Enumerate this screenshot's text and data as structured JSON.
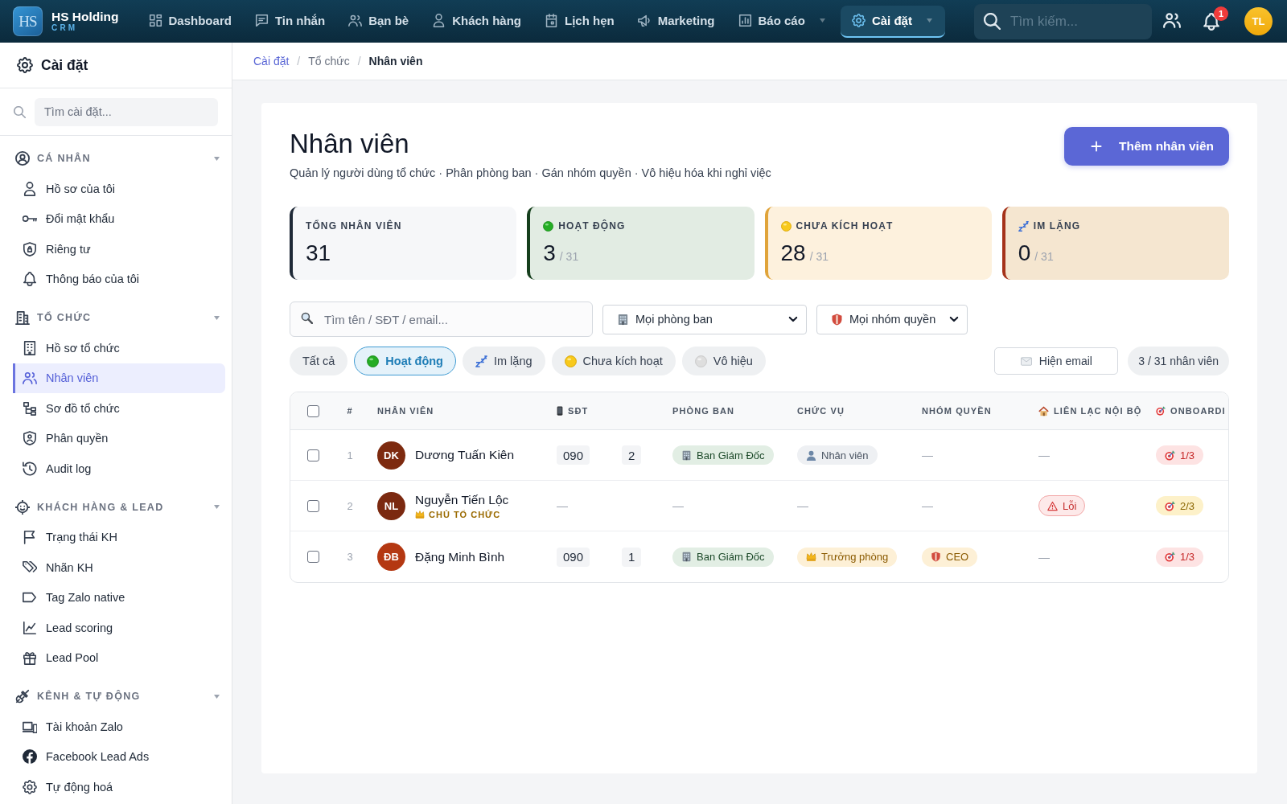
{
  "topbar": {
    "logo": {
      "mark": "HS",
      "name": "HS Holding",
      "tagline": "CRM"
    },
    "nav": [
      {
        "label": "Dashboard",
        "selected": false,
        "dropdown": false
      },
      {
        "label": "Tin nhắn",
        "selected": false,
        "dropdown": false
      },
      {
        "label": "Bạn bè",
        "selected": false,
        "dropdown": false
      },
      {
        "label": "Khách hàng",
        "selected": false,
        "dropdown": false
      },
      {
        "label": "Lịch hẹn",
        "selected": false,
        "dropdown": false
      },
      {
        "label": "Marketing",
        "selected": false,
        "dropdown": false
      },
      {
        "label": "Báo cáo",
        "selected": false,
        "dropdown": true
      },
      {
        "label": "Cài đặt",
        "selected": true,
        "dropdown": true
      }
    ],
    "search": {
      "placeholder": "Tìm kiếm..."
    },
    "notifications": {
      "count": "1"
    },
    "user": {
      "initials": "TL"
    }
  },
  "sidebar": {
    "title": "Cài đặt",
    "search": {
      "placeholder": "Tìm cài đặt..."
    },
    "sections": [
      {
        "title": "CÁ NHÂN",
        "expanded": true,
        "items": [
          {
            "label": "Hồ sơ của tôi",
            "selected": false
          },
          {
            "label": "Đổi mật khẩu",
            "selected": false
          },
          {
            "label": "Riêng tư",
            "selected": false
          },
          {
            "label": "Thông báo của tôi",
            "selected": false
          }
        ]
      },
      {
        "title": "TỔ CHỨC",
        "expanded": true,
        "items": [
          {
            "label": "Hồ sơ tổ chức",
            "selected": false
          },
          {
            "label": "Nhân viên",
            "selected": true
          },
          {
            "label": "Sơ đồ tổ chức",
            "selected": false
          },
          {
            "label": "Phân quyền",
            "selected": false
          },
          {
            "label": "Audit log",
            "selected": false
          }
        ]
      },
      {
        "title": "KHÁCH HÀNG & LEAD",
        "expanded": true,
        "items": [
          {
            "label": "Trạng thái KH",
            "selected": false
          },
          {
            "label": "Nhãn KH",
            "selected": false
          },
          {
            "label": "Tag Zalo native",
            "selected": false
          },
          {
            "label": "Lead scoring",
            "selected": false
          },
          {
            "label": "Lead Pool",
            "selected": false
          }
        ]
      },
      {
        "title": "KÊNH & TỰ ĐỘNG",
        "expanded": true,
        "items": [
          {
            "label": "Tài khoản Zalo",
            "selected": false
          },
          {
            "label": "Facebook Lead Ads",
            "selected": false
          },
          {
            "label": "Tự động hoá",
            "selected": false
          }
        ]
      }
    ]
  },
  "breadcrumb": [
    {
      "kind": "root",
      "label": "Cài đặt"
    },
    {
      "kind": "separator",
      "label": "/"
    },
    {
      "kind": "link",
      "label": "Tổ chức"
    },
    {
      "kind": "separator",
      "label": "/"
    },
    {
      "kind": "current",
      "label": "Nhân viên"
    }
  ],
  "page": {
    "title": "Nhân viên",
    "subtitle": "Quản lý người dùng tổ chức · Phân phòng ban · Gán nhóm quyền · Vô hiệu hóa khi nghỉ việc",
    "add_button": "Thêm nhân viên"
  },
  "stats": [
    {
      "kind": "total",
      "label": "TỔNG NHÂN VIÊN",
      "value": "31"
    },
    {
      "kind": "active",
      "label": "HOẠT ĐỘNG",
      "value": "3",
      "total": "/ 31"
    },
    {
      "kind": "pending",
      "label": "CHƯA KÍCH HOẠT",
      "value": "28",
      "total": "/ 31"
    },
    {
      "kind": "silent",
      "label": "IM LẶNG",
      "value": "0",
      "total": "/ 31"
    }
  ],
  "filters": {
    "search": {
      "placeholder": "Tìm tên / SĐT / email..."
    },
    "department": {
      "value": "Mọi phòng ban"
    },
    "role_group": {
      "value": "Mọi nhóm quyền"
    },
    "status_chips": [
      {
        "kind": "all",
        "label": "Tất cả",
        "selected": false
      },
      {
        "kind": "active",
        "label": "Hoạt động",
        "selected": true
      },
      {
        "kind": "silent",
        "label": "Im lặng",
        "selected": false
      },
      {
        "kind": "pending",
        "label": "Chưa kích hoạt",
        "selected": false
      },
      {
        "kind": "disabled",
        "label": "Vô hiệu",
        "selected": false
      }
    ],
    "email_toggle": {
      "label": "Hiện email"
    },
    "count": "3 / 31 nhân viên"
  },
  "table": {
    "select_all": false,
    "columns": [
      {
        "kind": "plain",
        "label": "#"
      },
      {
        "kind": "plain",
        "label": "NHÂN VIÊN"
      },
      {
        "kind": "phone",
        "label": "SĐT"
      },
      {
        "kind": "plain",
        "label": "PHÒNG BAN"
      },
      {
        "kind": "plain",
        "label": "CHỨC VỤ"
      },
      {
        "kind": "plain",
        "label": "NHÓM QUYỀN"
      },
      {
        "kind": "contact",
        "label": "LIÊN LẠC NỘI BỘ"
      },
      {
        "kind": "onboarding",
        "label": "ONBOARDI"
      }
    ],
    "rows": [
      {
        "checked": false,
        "number": "1",
        "avatar": {
          "initials": "DK",
          "color": "#7d2a0f"
        },
        "name": "Dương Tuấn Kiên",
        "phone": {
          "kind": "masked",
          "parts": [
            "090",
            "2"
          ]
        },
        "department": {
          "kind": "dept",
          "text": "Ban Giám Đốc"
        },
        "position": {
          "kind": "staff",
          "text": "Nhân viên"
        },
        "role_group": {
          "kind": "dash",
          "text": "—"
        },
        "contact": {
          "kind": "dash",
          "text": "—"
        },
        "onboarding": {
          "kind": "low",
          "text": "1/3"
        }
      },
      {
        "checked": false,
        "number": "2",
        "avatar": {
          "initials": "NL",
          "color": "#7b2910"
        },
        "name": "Nguyễn Tiến Lộc",
        "badge": "CHỦ TỔ CHỨC",
        "phone": {
          "kind": "dash",
          "text": "—"
        },
        "department": {
          "kind": "dash",
          "text": "—"
        },
        "position": {
          "kind": "dash",
          "text": "—"
        },
        "role_group": {
          "kind": "dash",
          "text": "—"
        },
        "contact": {
          "kind": "error",
          "text": "Lỗi"
        },
        "onboarding": {
          "kind": "mid",
          "text": "2/3"
        }
      },
      {
        "checked": false,
        "number": "3",
        "avatar": {
          "initials": "ĐB",
          "color": "#b43812"
        },
        "name": "Đặng Minh Bình",
        "phone": {
          "kind": "masked",
          "parts": [
            "090",
            "1"
          ]
        },
        "department": {
          "kind": "dept",
          "text": "Ban Giám Đốc"
        },
        "position": {
          "kind": "head",
          "text": "Trưởng phòng"
        },
        "role_group": {
          "kind": "role",
          "text": "CEO"
        },
        "contact": {
          "kind": "dash",
          "text": "—"
        },
        "onboarding": {
          "kind": "low",
          "text": "1/3"
        }
      }
    ]
  }
}
